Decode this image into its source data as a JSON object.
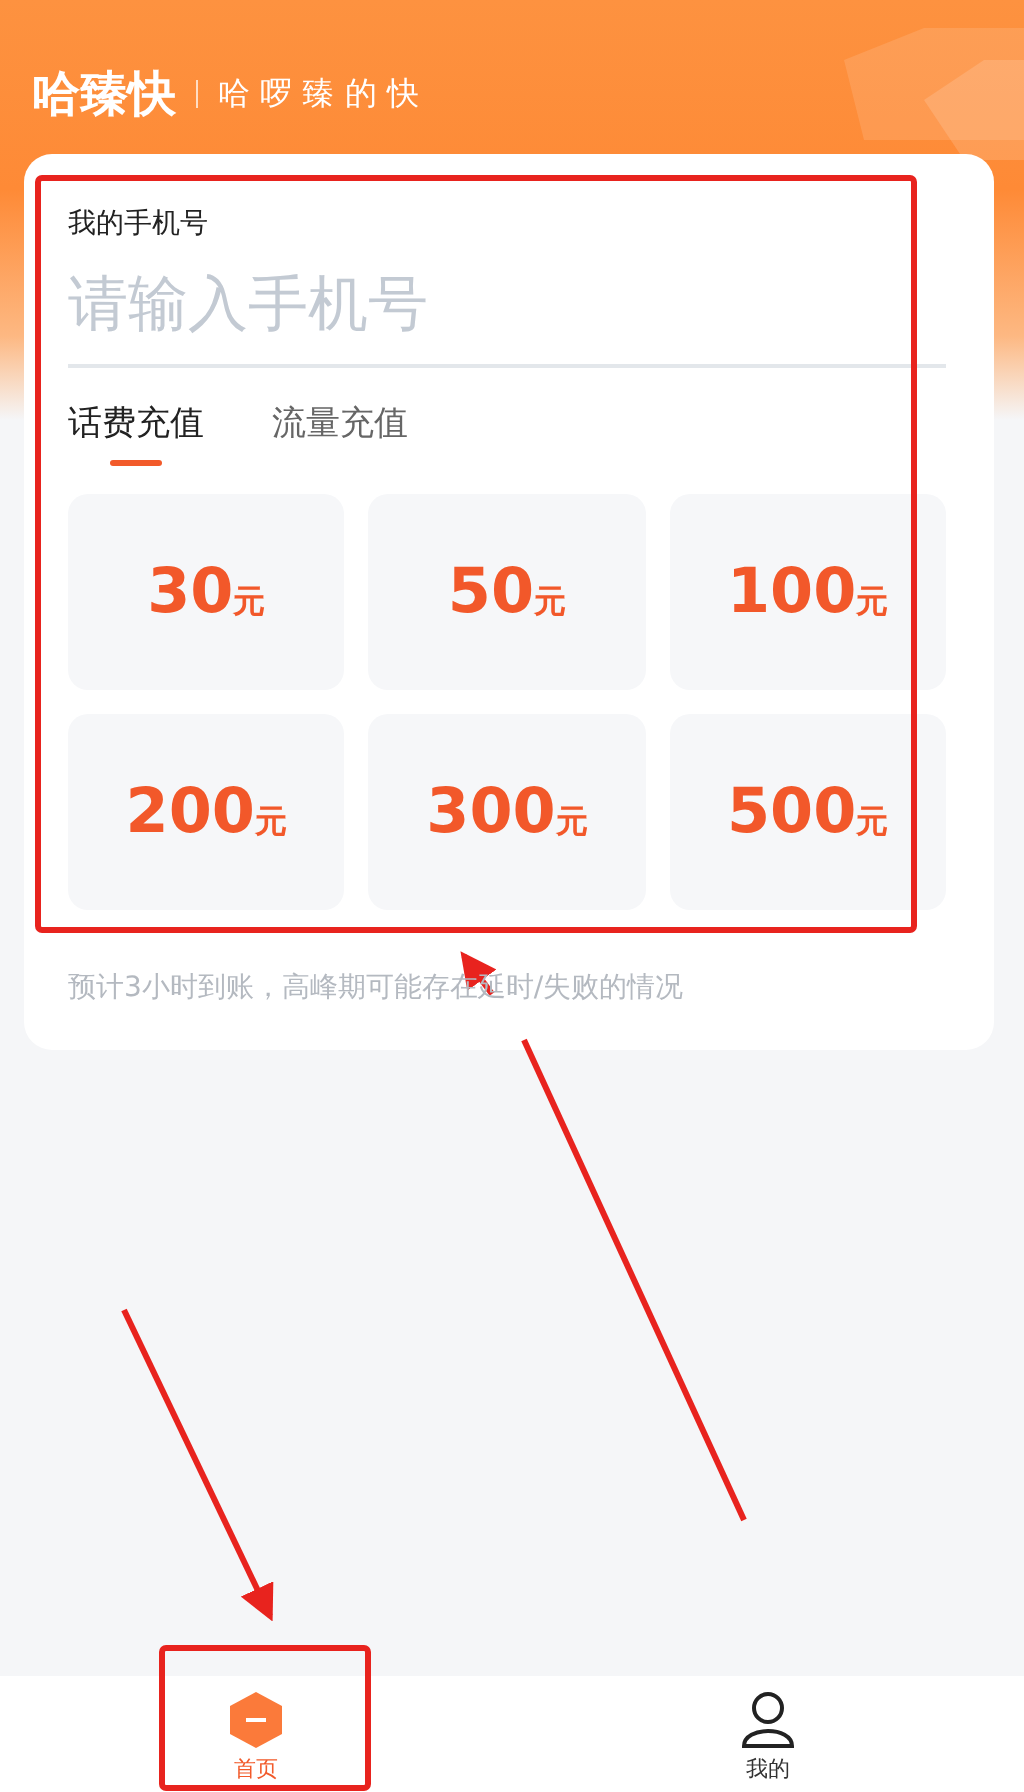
{
  "header": {
    "brand": "哈臻快",
    "slogan": "哈 啰 臻 的 快"
  },
  "form": {
    "label": "我的手机号",
    "placeholder": "请输入手机号"
  },
  "tabs": [
    {
      "label": "话费充值",
      "selected": true
    },
    {
      "label": "流量充值",
      "selected": false
    }
  ],
  "amounts": [
    {
      "value": "30",
      "unit": "元"
    },
    {
      "value": "50",
      "unit": "元"
    },
    {
      "value": "100",
      "unit": "元"
    },
    {
      "value": "200",
      "unit": "元"
    },
    {
      "value": "300",
      "unit": "元"
    },
    {
      "value": "500",
      "unit": "元"
    }
  ],
  "note": "预计3小时到账，高峰期可能存在延时/失败的情况",
  "bottom_nav": [
    {
      "label": "首页",
      "kind": "home",
      "selected": true
    },
    {
      "label": "我的",
      "kind": "profile",
      "selected": false
    }
  ]
}
